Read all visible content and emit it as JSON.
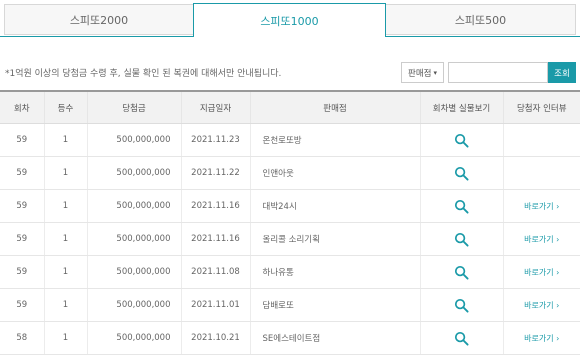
{
  "tabs": [
    {
      "label": "스피또2000"
    },
    {
      "label": "스피또1000"
    },
    {
      "label": "스피또500"
    }
  ],
  "notice": "*1억원 이상의 당첨금 수령 후, 실물 확인 된 복권에 대해서만 안내됩니다.",
  "filter": {
    "label": "판매점",
    "arrow": "▾"
  },
  "search": {
    "placeholder": "",
    "button": "조회"
  },
  "table": {
    "headers": [
      "회차",
      "등수",
      "당첨금",
      "지급일자",
      "판매점",
      "회차별 실물보기",
      "당첨자 인터뷰"
    ],
    "rows": [
      {
        "round": "59",
        "rank": "1",
        "prize": "500,000,000",
        "date": "2021.11.23",
        "store": "온천로또방",
        "interview": ""
      },
      {
        "round": "59",
        "rank": "1",
        "prize": "500,000,000",
        "date": "2021.11.22",
        "store": "인앤아웃",
        "interview": ""
      },
      {
        "round": "59",
        "rank": "1",
        "prize": "500,000,000",
        "date": "2021.11.16",
        "store": "대박24시",
        "interview": "바로가기 ›"
      },
      {
        "round": "59",
        "rank": "1",
        "prize": "500,000,000",
        "date": "2021.11.16",
        "store": "올리콜 소리기획",
        "interview": "바로가기 ›"
      },
      {
        "round": "59",
        "rank": "1",
        "prize": "500,000,000",
        "date": "2021.11.08",
        "store": "하나유통",
        "interview": "바로가기 ›"
      },
      {
        "round": "59",
        "rank": "1",
        "prize": "500,000,000",
        "date": "2021.11.01",
        "store": "담배로또",
        "interview": "바로가기 ›"
      },
      {
        "round": "58",
        "rank": "1",
        "prize": "500,000,000",
        "date": "2021.10.21",
        "store": "SE에스테이트점",
        "interview": "바로가기 ›"
      }
    ]
  },
  "colors": {
    "accent": "#1a9aa8"
  }
}
